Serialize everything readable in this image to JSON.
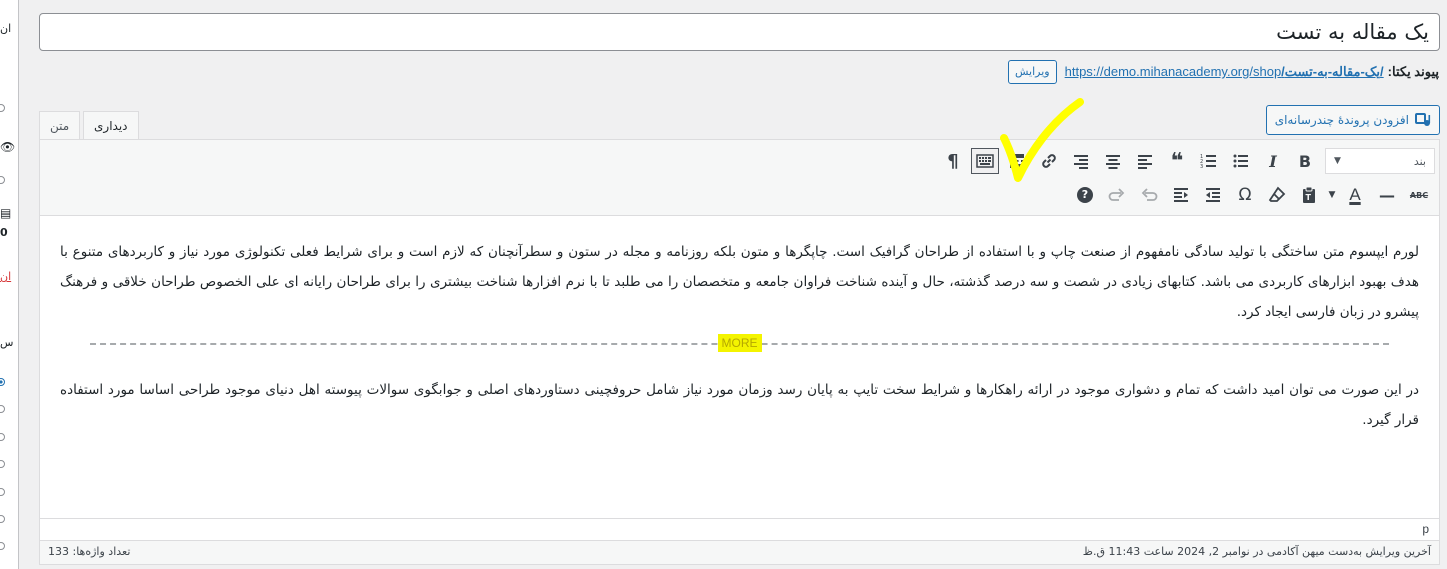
{
  "sidebar_fragments": {
    "top": "ان",
    "number": "0",
    "link": "ان",
    "label": "س"
  },
  "title": {
    "value": "یک مقاله به تست"
  },
  "permalink": {
    "label": "پیوند یکتا:",
    "base_url": "https://demo.mihanacademy.org/shop",
    "slug": "/یک-مقاله-به-تست/",
    "edit_button": "ویرایش"
  },
  "add_media": {
    "label": "افزودن پروندهٔ چندرسانه‌ای",
    "icon": "media-icon"
  },
  "tabs": [
    {
      "label": "دیداری",
      "active": true
    },
    {
      "label": "متن",
      "active": false
    }
  ],
  "toolbar": {
    "format_select": "بند",
    "row1_icons": [
      "bold-icon",
      "italic-icon",
      "bullet-list-icon",
      "numbered-list-icon",
      "blockquote-icon",
      "align-left-icon",
      "align-center-icon",
      "align-right-icon",
      "link-icon",
      "read-more-icon",
      "toolbar-toggle-icon",
      "rtl-icon"
    ],
    "row2_icons": [
      "strikethrough-icon",
      "horizontal-line-icon",
      "text-color-icon",
      "dropdown-icon",
      "paste-text-icon",
      "clear-format-icon",
      "special-char-icon",
      "outdent-icon",
      "indent-icon",
      "undo-icon",
      "redo-icon",
      "help-icon"
    ],
    "row1_glyphs": {
      "bold": "B",
      "italic": "I",
      "quote": "❝",
      "rtl": "¶"
    },
    "row2_glyphs": {
      "strike": "ABC",
      "hr": "—",
      "color": "A",
      "omega": "Ω",
      "help": "?"
    }
  },
  "content": {
    "paragraph1": "لورم ایپسوم متن ساختگی با تولید سادگی نامفهوم از صنعت چاپ و با استفاده از طراحان گرافیک است. چاپگرها و متون بلکه روزنامه و مجله در ستون و سطرآنچنان که لازم است و برای شرایط فعلی تکنولوژی مورد نیاز و کاربردهای متنوع با هدف بهبود ابزارهای کاربردی می باشد. کتابهای زیادی در شصت و سه درصد گذشته، حال و آینده شناخت فراوان جامعه و متخصصان را می طلبد تا با نرم افزارها شناخت بیشتری را برای طراحان رایانه ای علی الخصوص طراحان خلاقی و فرهنگ پیشرو در زبان فارسی ایجاد کرد.",
    "more_tag": "MORE",
    "paragraph2": "در این صورت می توان امید داشت که تمام و دشواری موجود در ارائه راهکارها و شرایط سخت تایپ به پایان رسد وزمان مورد نیاز شامل حروفچینی دستاوردهای اصلی و جوابگوی سوالات پیوسته اهل دنیای موجود طراحی اساسا مورد استفاده قرار گیرد."
  },
  "path_bar": {
    "path": "p"
  },
  "status": {
    "word_count": "تعداد واژه‌ها: 133",
    "last_edit": "آخرین ویرایش به‌دست میهن آکادمی در نوامبر 2, 2024 ساعت 11:43 ق.ظ"
  },
  "colors": {
    "accent": "#2271b1",
    "highlight": "#f4f400",
    "annotation": "#ffff00"
  }
}
